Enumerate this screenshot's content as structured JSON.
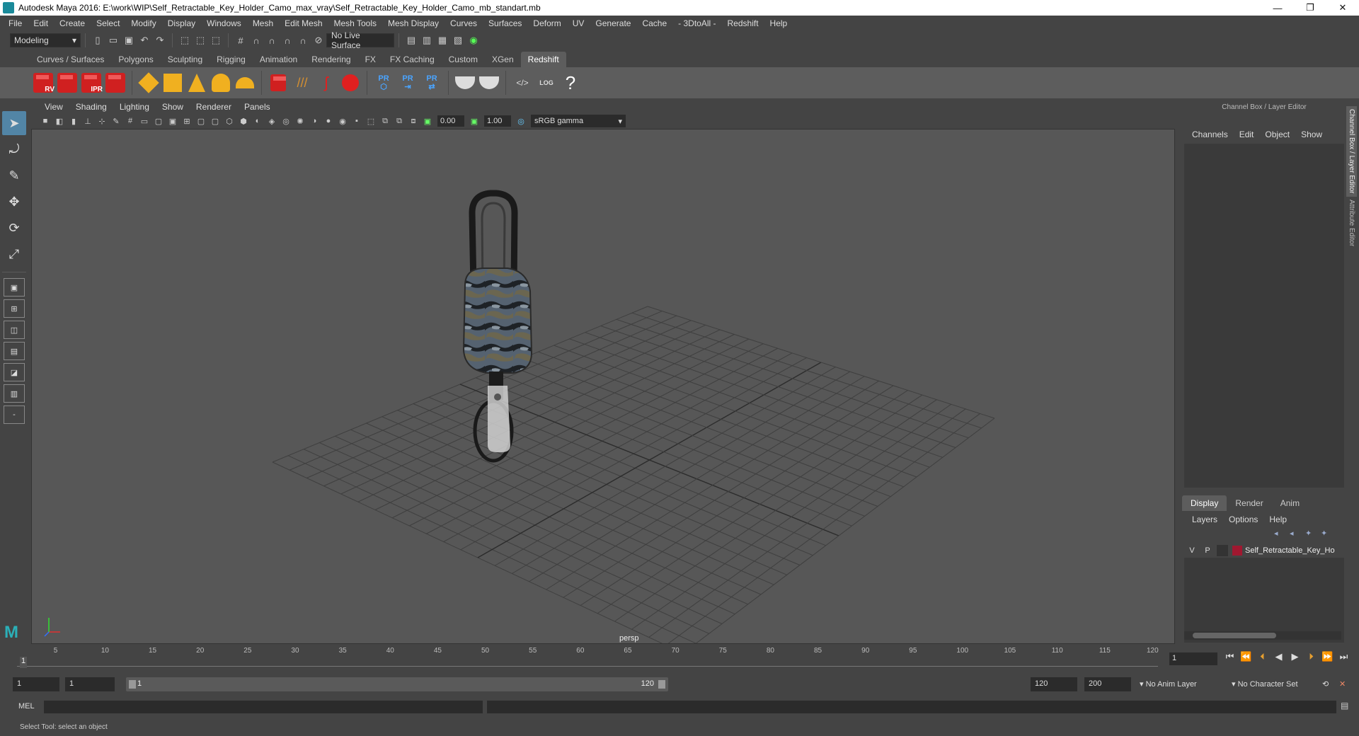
{
  "window": {
    "title": "Autodesk Maya 2016: E:\\work\\WIP\\Self_Retractable_Key_Holder_Camo_max_vray\\Self_Retractable_Key_Holder_Camo_mb_standart.mb",
    "minimize": "—",
    "restore": "❐",
    "close": "✕"
  },
  "menubar": [
    "File",
    "Edit",
    "Create",
    "Select",
    "Modify",
    "Display",
    "Windows",
    "Mesh",
    "Edit Mesh",
    "Mesh Tools",
    "Mesh Display",
    "Curves",
    "Surfaces",
    "Deform",
    "UV",
    "Generate",
    "Cache",
    "- 3DtoAll -",
    "Redshift",
    "Help"
  ],
  "statusline": {
    "mode": "Modeling",
    "live_surface": "No Live Surface"
  },
  "shelf": {
    "tabs": [
      "Curves / Surfaces",
      "Polygons",
      "Sculpting",
      "Rigging",
      "Animation",
      "Rendering",
      "FX",
      "FX Caching",
      "Custom",
      "XGen",
      "Redshift"
    ],
    "active_tab": "Redshift",
    "rs_labels": [
      "RV",
      "",
      "IPR",
      ""
    ],
    "pr_label": "PR",
    "log_label": "LOG",
    "help_label": "?"
  },
  "viewport": {
    "menus": [
      "View",
      "Shading",
      "Lighting",
      "Show",
      "Renderer",
      "Panels"
    ],
    "exposure": "0.00",
    "gamma_value": "1.00",
    "color_space": "sRGB gamma",
    "camera_label": "persp",
    "bg_color": "#575757",
    "grid_color": "#3f3f3f"
  },
  "channel_box": {
    "title": "Channel Box / Layer Editor",
    "menus": [
      "Channels",
      "Edit",
      "Object",
      "Show"
    ]
  },
  "side_tabs": [
    "Channel Box / Layer Editor",
    "Attribute Editor"
  ],
  "layer_editor": {
    "tabs": [
      "Display",
      "Render",
      "Anim"
    ],
    "active_tab": "Display",
    "menus": [
      "Layers",
      "Options",
      "Help"
    ],
    "layer": {
      "v": "V",
      "p": "P",
      "name": "Self_Retractable_Key_Ho",
      "color": "#a01830"
    }
  },
  "timeline": {
    "ticks": [
      "5",
      "10",
      "15",
      "20",
      "25",
      "30",
      "35",
      "40",
      "45",
      "50",
      "55",
      "60",
      "65",
      "70",
      "75",
      "80",
      "85",
      "90",
      "95",
      "100",
      "105",
      "110",
      "115",
      "120"
    ],
    "current_frame_marker": "1",
    "current_frame": "1"
  },
  "range": {
    "start": "1",
    "playback_start": "1",
    "slider_start": "1",
    "slider_end": "120",
    "playback_end": "120",
    "end": "200",
    "anim_layer": "No Anim Layer",
    "character_set": "No Character Set"
  },
  "commandline": {
    "label": "MEL"
  },
  "helpline": {
    "text": "Select Tool: select an object"
  }
}
